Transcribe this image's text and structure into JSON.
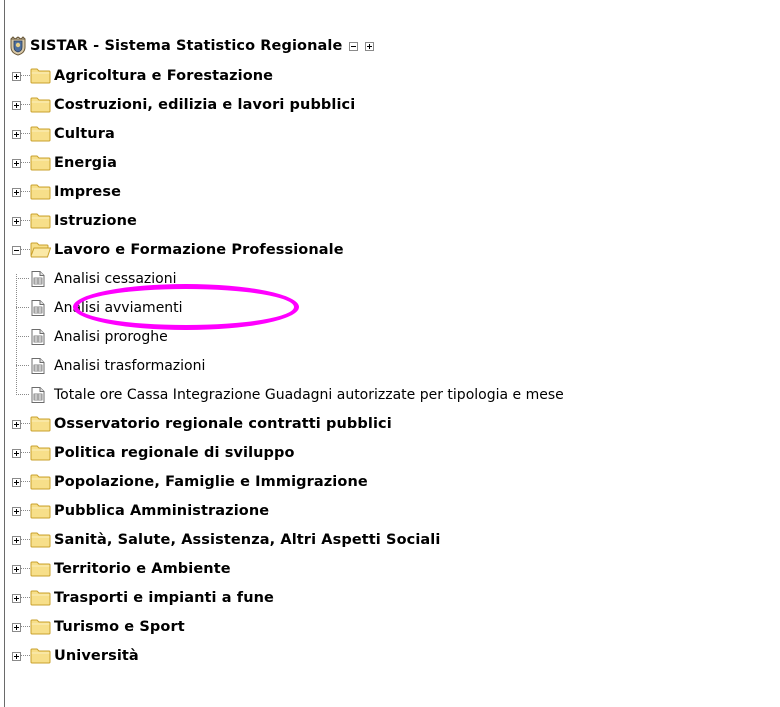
{
  "root": {
    "label": "SISTAR - Sistema Statistico Regionale",
    "crest_icon": "regional-crest-icon",
    "collapse_all_icon": "collapse-all-icon",
    "expand_all_icon": "expand-all-icon"
  },
  "categories": [
    {
      "label": "Agricoltura e Forestazione",
      "expanded": false
    },
    {
      "label": "Costruzioni, edilizia e lavori pubblici",
      "expanded": false
    },
    {
      "label": "Cultura",
      "expanded": false
    },
    {
      "label": "Energia",
      "expanded": false
    },
    {
      "label": "Imprese",
      "expanded": false
    },
    {
      "label": "Istruzione",
      "expanded": false
    },
    {
      "label": "Lavoro e Formazione Professionale",
      "expanded": true,
      "children": [
        {
          "label": "Analisi cessazioni"
        },
        {
          "label": "Analisi avviamenti",
          "highlighted": true
        },
        {
          "label": "Analisi proroghe"
        },
        {
          "label": "Analisi trasformazioni"
        },
        {
          "label": "Totale ore Cassa Integrazione Guadagni autorizzate per tipologia e mese"
        }
      ]
    },
    {
      "label": "Osservatorio regionale contratti pubblici",
      "expanded": false
    },
    {
      "label": "Politica regionale di sviluppo",
      "expanded": false
    },
    {
      "label": "Popolazione, Famiglie e Immigrazione",
      "expanded": false
    },
    {
      "label": "Pubblica Amministrazione",
      "expanded": false
    },
    {
      "label": "Sanità, Salute, Assistenza, Altri Aspetti Sociali",
      "expanded": false
    },
    {
      "label": "Territorio e Ambiente",
      "expanded": false
    },
    {
      "label": "Trasporti e impianti a fune",
      "expanded": false
    },
    {
      "label": "Turismo e Sport",
      "expanded": false
    },
    {
      "label": "Università",
      "expanded": false
    }
  ],
  "colors": {
    "highlight": "#ff00ff",
    "folder_fill": "#f7df8a",
    "folder_stroke": "#c9a02c"
  }
}
